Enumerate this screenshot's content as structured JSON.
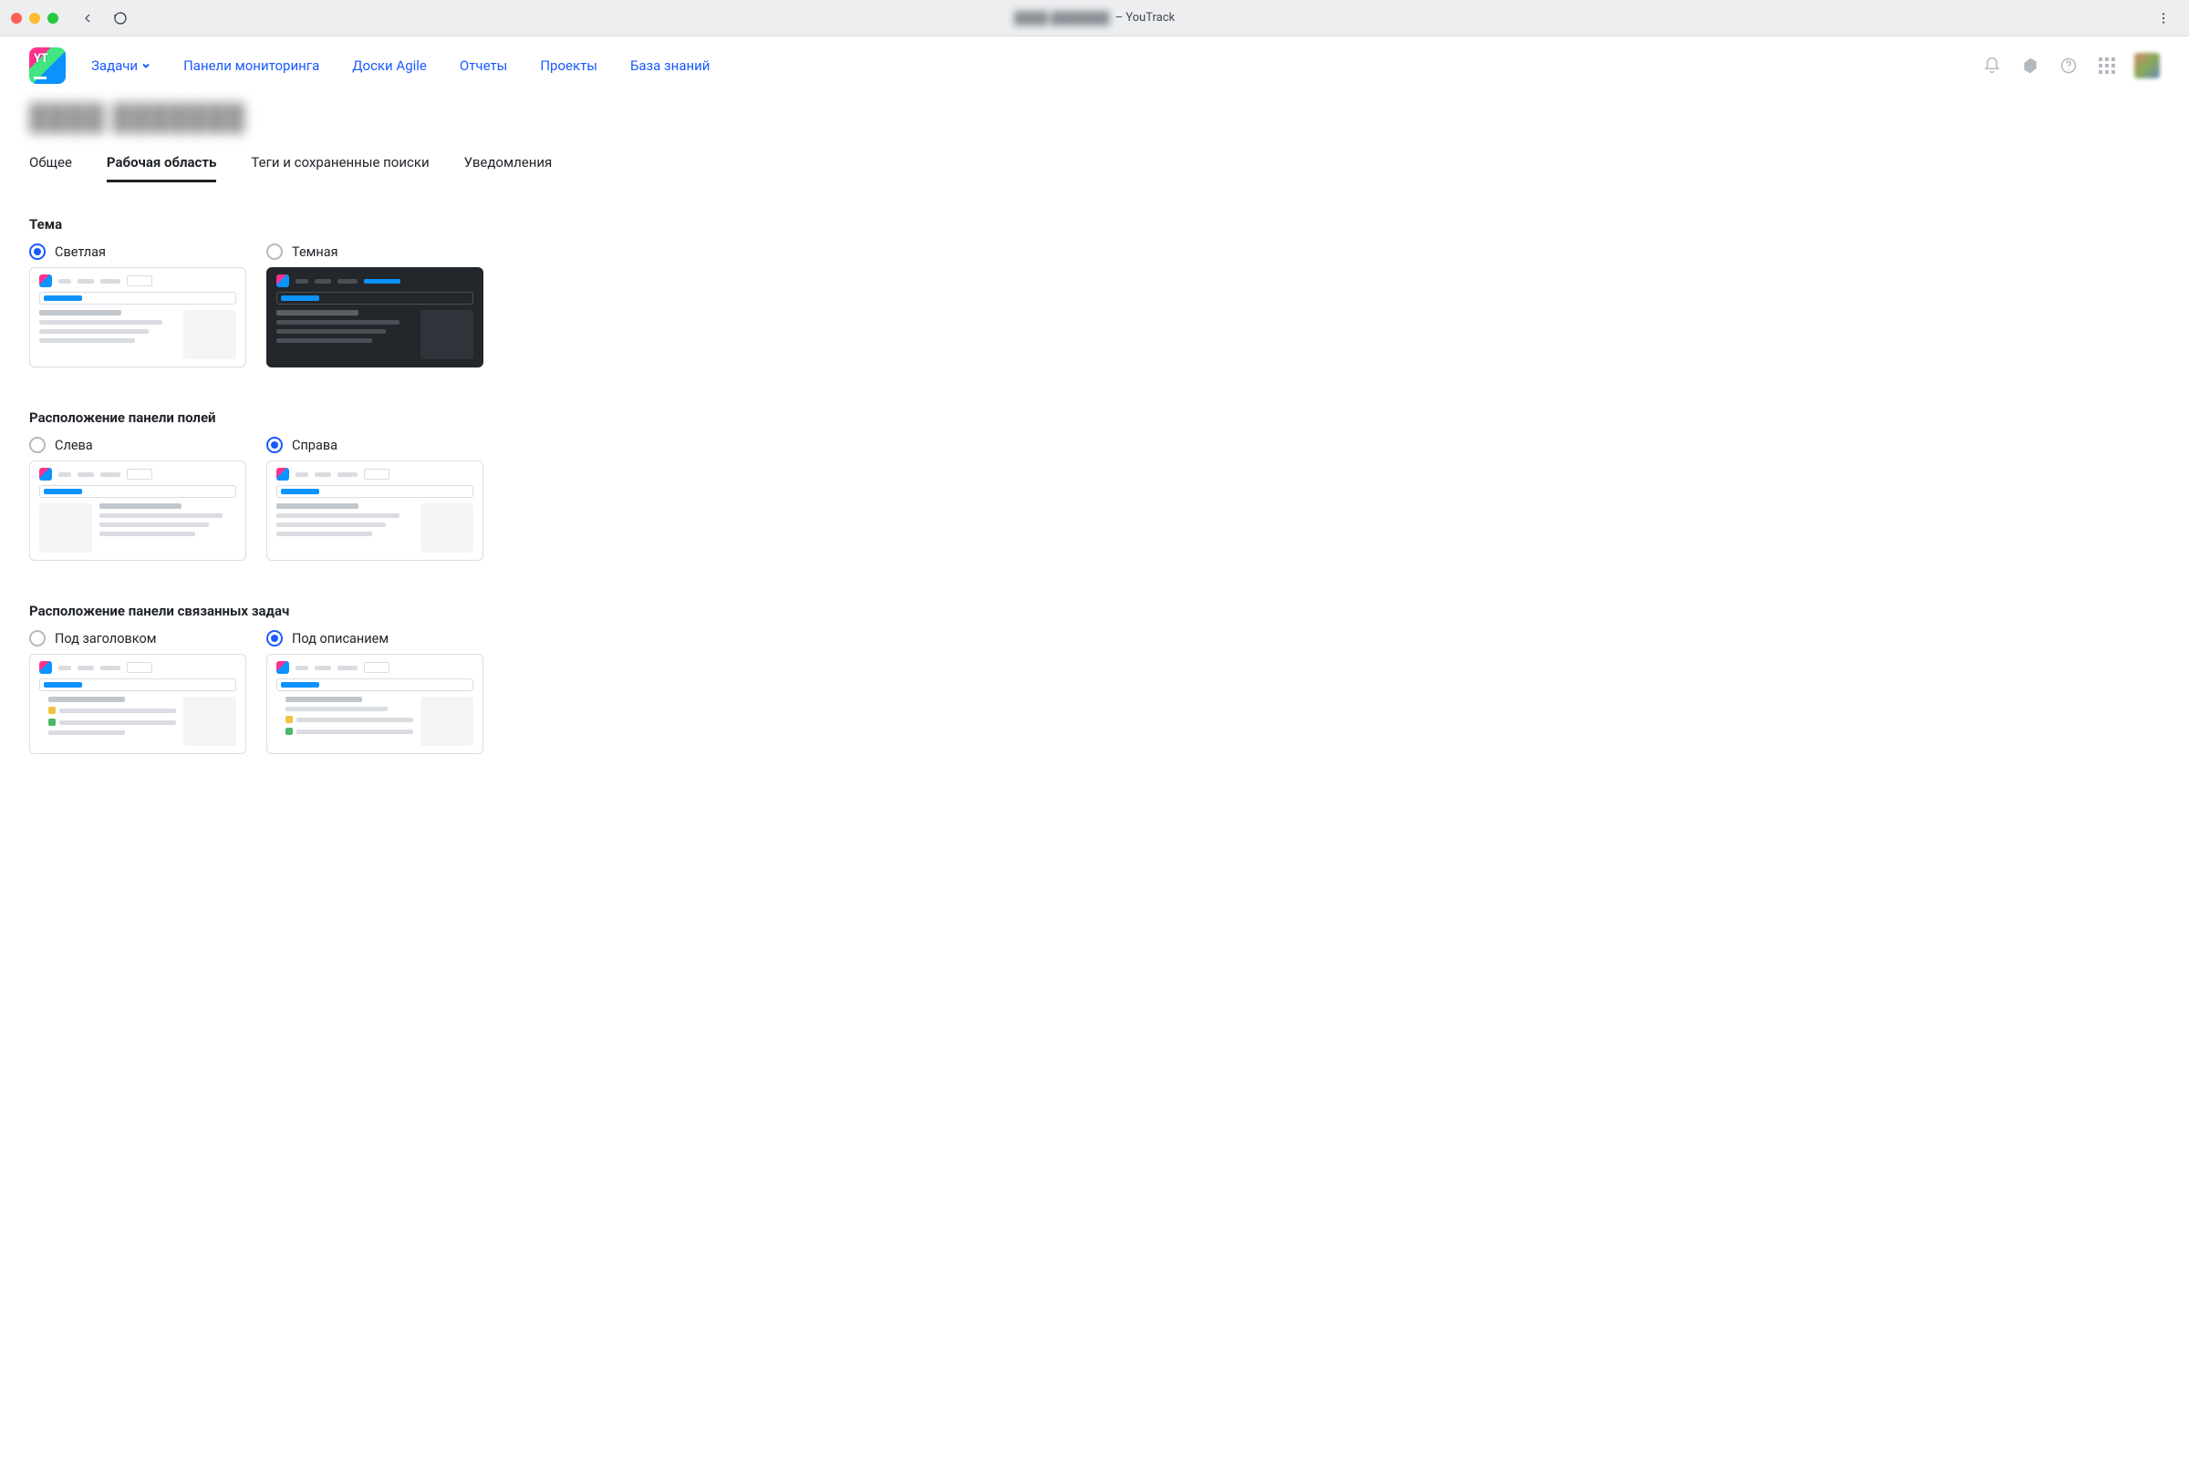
{
  "browser": {
    "title_blurred": "████ ███████",
    "title_suffix": " – YouTrack"
  },
  "nav": {
    "issues": "Задачи",
    "dashboards": "Панели мониторинга",
    "agile": "Доски Agile",
    "reports": "Отчеты",
    "projects": "Проекты",
    "kb": "База знаний"
  },
  "page": {
    "title_blurred": "████ ███████"
  },
  "tabs": {
    "general": "Общее",
    "workspace": "Рабочая область",
    "tags": "Теги и сохраненные поиски",
    "notifications": "Уведомления"
  },
  "sections": {
    "theme": {
      "title": "Тема",
      "light": "Светлая",
      "dark": "Темная",
      "selected": "light"
    },
    "fields_panel": {
      "title": "Расположение панели полей",
      "left": "Слева",
      "right": "Справа",
      "selected": "right"
    },
    "linked_panel": {
      "title": "Расположение панели связанных задач",
      "under_title": "Под заголовком",
      "under_desc": "Под описанием",
      "selected": "under_desc"
    }
  }
}
